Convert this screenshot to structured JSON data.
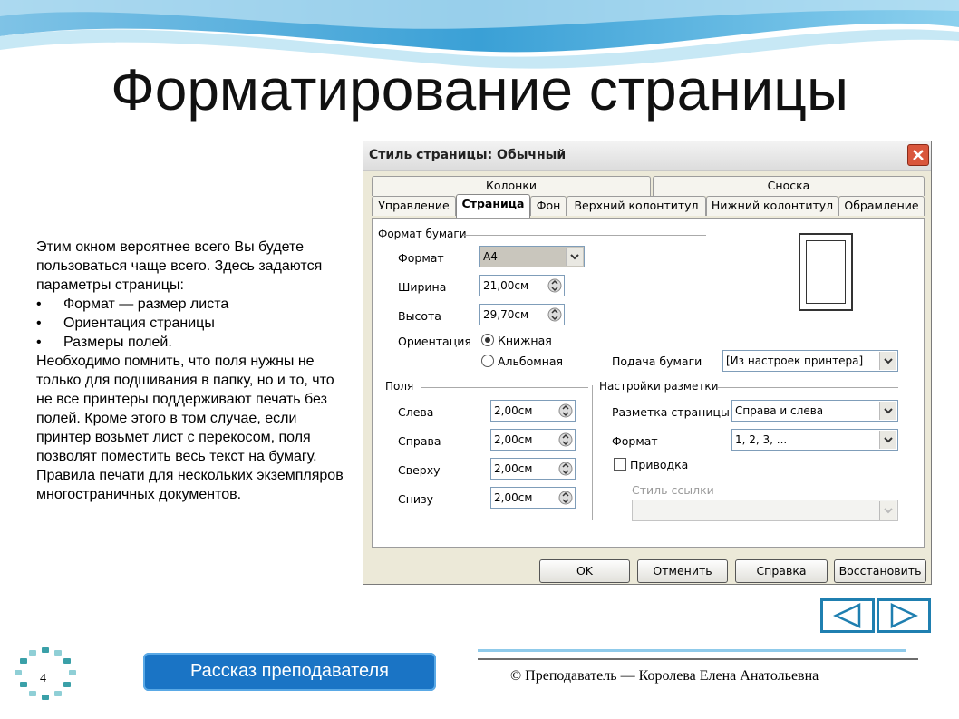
{
  "slide": {
    "title": "Форматирование страницы",
    "page_number": "4",
    "footer": "© Преподаватель — Королева Елена Анатольевна",
    "story_button": "Рассказ преподавателя"
  },
  "left_text": {
    "intro": "Этим окном вероятнее всего Вы будете пользоваться чаще всего. Здесь задаются параметры страницы:",
    "bullets": [
      "Формат — размер листа",
      "Ориентация страницы",
      "Размеры полей."
    ],
    "para1": "Необходимо помнить, что поля нужны не только для подшивания в папку,  но и то, что не все принтеры поддерживают печать без полей. Кроме этого в том случае, если принтер возьмет лист с перекосом, поля позволят поместить весь текст на бумагу.",
    "para2": "Правила печати для нескольких экземпляров многостраничных документов."
  },
  "dialog": {
    "title": "Стиль страницы: Обычный",
    "tabs_row1": [
      "Колонки",
      "Сноска"
    ],
    "tabs_row2": [
      "Управление",
      "Страница",
      "Фон",
      "Верхний колонтитул",
      "Нижний колонтитул",
      "Обрамление"
    ],
    "active_tab": "Страница",
    "paper_format": {
      "section": "Формат бумаги",
      "format_label": "Формат",
      "format_value": "A4",
      "width_label": "Ширина",
      "width_value": "21,00см",
      "height_label": "Высота",
      "height_value": "29,70см",
      "orientation_label": "Ориентация",
      "portrait": "Книжная",
      "landscape": "Альбомная",
      "feed_label": "Подача бумаги",
      "feed_value": "[Из настроек принтера]"
    },
    "margins": {
      "section": "Поля",
      "left_label": "Слева",
      "left_value": "2,00см",
      "right_label": "Справа",
      "right_value": "2,00см",
      "top_label": "Сверху",
      "top_value": "2,00см",
      "bottom_label": "Снизу",
      "bottom_value": "2,00см"
    },
    "layout": {
      "section": "Настройки разметки",
      "layout_label": "Разметка страницы",
      "layout_value": "Справа и слева",
      "format_label": "Формат",
      "format_value": "1, 2, 3, ...",
      "register_label": "Приводка",
      "ref_style_label": "Стиль ссылки"
    },
    "buttons": {
      "ok": "OK",
      "cancel": "Отменить",
      "help": "Справка",
      "reset": "Восстановить"
    }
  },
  "colors": {
    "accent": "#1f7fb0",
    "story_button": "#1a74c5",
    "close_button": "#d9563c"
  }
}
